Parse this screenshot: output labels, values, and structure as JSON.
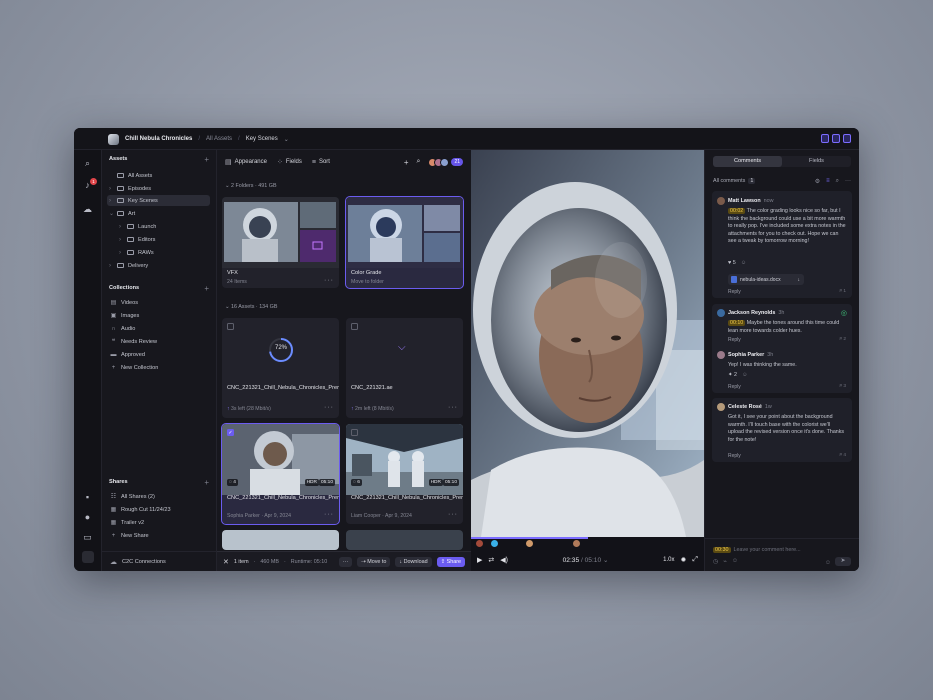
{
  "topbar": {
    "project": "Chill Nebula Chronicles",
    "crumb_all": "All Assets",
    "crumb_current": "Key Scenes"
  },
  "rail": {
    "notification_count": "1"
  },
  "sidebar": {
    "assets_heading": "Assets",
    "tree": [
      {
        "label": "All Assets"
      },
      {
        "label": "Episodes"
      },
      {
        "label": "Key Scenes"
      },
      {
        "label": "Art"
      },
      {
        "label": "Launch"
      },
      {
        "label": "Editors"
      },
      {
        "label": "RAWs"
      },
      {
        "label": "Delivery"
      }
    ],
    "collections_heading": "Collections",
    "collections": [
      {
        "label": "Videos"
      },
      {
        "label": "Images"
      },
      {
        "label": "Audio"
      },
      {
        "label": "Needs Review"
      },
      {
        "label": "Approved"
      },
      {
        "label": "New Collection"
      }
    ],
    "shares_heading": "Shares",
    "shares": [
      {
        "label": "All Shares (2)"
      },
      {
        "label": "Rough Cut 11/24/23"
      },
      {
        "label": "Trailer v2"
      },
      {
        "label": "New Share"
      }
    ],
    "c2c": "C2C Connections"
  },
  "grid": {
    "toolbar": {
      "appearance": "Appearance",
      "fields": "Fields",
      "sort": "Sort",
      "viewer_count": "21"
    },
    "folders_label": "2 Folders",
    "folders_size": "491 GB",
    "folders": [
      {
        "name": "VFX",
        "sub": "24 Items"
      },
      {
        "name": "Color Grade",
        "sub": "Move to folder"
      }
    ],
    "drag_count": "3",
    "assets_label": "16 Assets",
    "assets_size": "134 GB",
    "assets": [
      {
        "name": "CNC_221321_Chill_Nebula_Chronicles_Premiere_Astronaut_CU_Scene_001.mov",
        "sub": "3s left (28 Mbit/s)",
        "progress": "72%"
      },
      {
        "name": "CNC_221321.ae",
        "sub": "2m left (8 Mbit/s)"
      },
      {
        "name": "CNC_221321_Chill_Nebula_Chronicles_Premiere_Space_Tent_Wide_Scene_003.mov",
        "author": "Sophia Parker",
        "date": "Apr 9, 2024",
        "comments": "4",
        "hdr": "HDR",
        "duration": "05:10"
      },
      {
        "name": "CNC_221321_Chill_Nebula_Chronicles_Premiere_Space_Tent_Wide_Scene_004.mov",
        "author": "Liam Cooper",
        "date": "Apr 9, 2024",
        "comments": "6",
        "hdr": "HDR",
        "duration": "05:10"
      }
    ],
    "selbar": {
      "count": "1 item",
      "size": "460 MB",
      "runtime": "Runtime: 05:10",
      "move": "Move to",
      "download": "Download",
      "share": "Share"
    }
  },
  "viewer": {
    "current": "02:35",
    "total": "05:10",
    "speed": "1.0x"
  },
  "comments": {
    "tab_comments": "Comments",
    "tab_fields": "Fields",
    "all_label": "All comments",
    "all_count": "1",
    "items": [
      {
        "author": "Matt Lawson",
        "time": "now",
        "ts": "00:02",
        "text": "The color grading looks nice so far, but I think the background could use a bit more warmth to really pop. I've included some extra notes in the attachments for you to check out. Hope we can see a tweak by tomorrow morning!",
        "reaction": "5",
        "attachment": "nebula-ideas.docx",
        "reply": "Reply",
        "num": "1"
      },
      {
        "author": "Jackson Reynolds",
        "time": "3h",
        "ts": "00:10",
        "text": "Maybe the tones around this time could lean more towards colder hues.",
        "reply": "Reply",
        "num": "2"
      },
      {
        "author": "Sophia Parker",
        "time": "3h",
        "text": "Yep! I was thinking the same.",
        "reaction": "2",
        "reply": "Reply",
        "num": "3"
      },
      {
        "author": "Celeste Rosé",
        "time": "1w",
        "text": "Got it, I see your point about the background warmth. I'll touch base with the colorist we'll upload the revised version once it's done. Thanks for the note!",
        "reply": "Reply",
        "num": "4"
      }
    ],
    "input_ts": "00:30",
    "input_placeholder": "Leave your comment here..."
  }
}
